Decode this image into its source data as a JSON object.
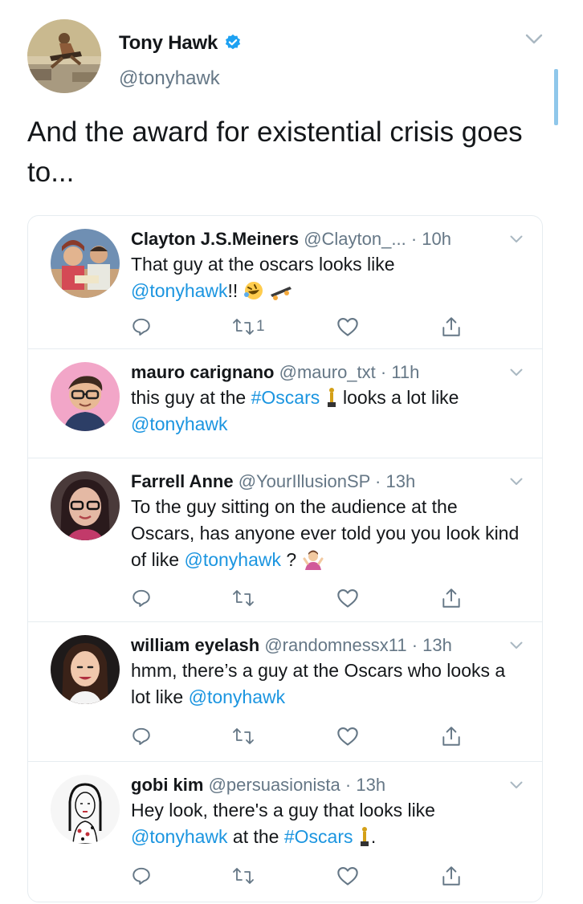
{
  "author": {
    "name": "Tony Hawk",
    "handle": "@tonyhawk"
  },
  "tweet": {
    "text": "And the award for existential crisis goes to..."
  },
  "replies": [
    {
      "name": "Clayton J.S.Meiners",
      "handle": "@Clayton_...",
      "time": "· 10h",
      "text": "That guy at the oscars looks like",
      "mention": "@tonyhawk",
      "suffix": "!!",
      "retweets": "1"
    },
    {
      "name": "mauro carignano",
      "handle": "@mauro_txt",
      "time": "· 11h",
      "text_before": "this guy at the",
      "hashtag": "#Oscars",
      "text_after": "looks a lot like",
      "mention": "@tonyhawk"
    },
    {
      "name": "Farrell Anne",
      "handle": "@YourIllusionSP",
      "time": "· 13h",
      "text": "To the guy sitting on the audience at the Oscars, has anyone ever told you you look kind of like",
      "mention": "@tonyhawk",
      "suffix": "?"
    },
    {
      "name": "william eyelash",
      "handle": "@randomnessx11",
      "time": "· 13h",
      "text": "hmm, there’s a guy at the Oscars who looks a lot like",
      "mention": "@tonyhawk"
    },
    {
      "name": "gobi kim",
      "handle": "@persuasionista",
      "time": "· 13h",
      "text": "Hey look, there's a guy that looks like",
      "mention": "@tonyhawk",
      "middle": "at the",
      "hashtag": "#Oscars",
      "suffix": "."
    }
  ],
  "icons": {
    "reply": "reply-icon",
    "retweet": "retweet-icon",
    "like": "heart-icon",
    "share": "share-icon",
    "caret": "chevron-down-icon",
    "verified": "verified-badge-icon"
  },
  "colors": {
    "link": "#1b95e0",
    "secondary_text": "#657786",
    "border": "#e6ecf0",
    "verified": "#1da1f2"
  }
}
